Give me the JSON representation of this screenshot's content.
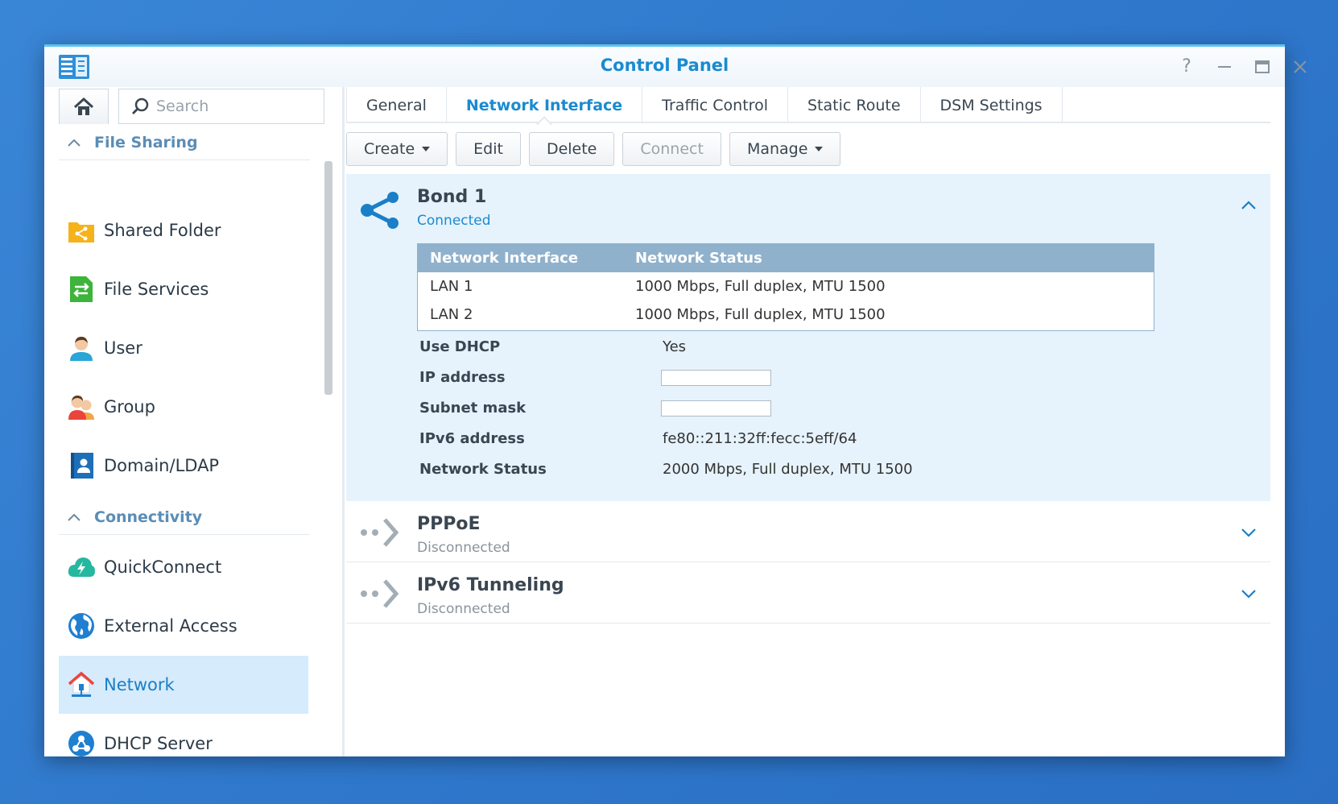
{
  "window": {
    "title": "Control Panel"
  },
  "sidebar": {
    "search_placeholder": "Search",
    "sections": [
      {
        "label": "File Sharing"
      },
      {
        "label": "Connectivity"
      }
    ],
    "items": [
      {
        "label": "Shared Folder",
        "icon": "shared-folder-icon"
      },
      {
        "label": "File Services",
        "icon": "file-services-icon"
      },
      {
        "label": "User",
        "icon": "user-icon"
      },
      {
        "label": "Group",
        "icon": "group-icon"
      },
      {
        "label": "Domain/LDAP",
        "icon": "domain-ldap-icon"
      },
      {
        "label": "QuickConnect",
        "icon": "quickconnect-icon"
      },
      {
        "label": "External Access",
        "icon": "external-access-icon"
      },
      {
        "label": "Network",
        "icon": "network-icon",
        "active": true
      },
      {
        "label": "DHCP Server",
        "icon": "dhcp-server-icon"
      }
    ]
  },
  "tabs": [
    {
      "label": "General"
    },
    {
      "label": "Network Interface",
      "active": true
    },
    {
      "label": "Traffic Control"
    },
    {
      "label": "Static Route"
    },
    {
      "label": "DSM Settings"
    }
  ],
  "toolbar": {
    "create": "Create",
    "edit": "Edit",
    "delete": "Delete",
    "connect": "Connect",
    "manage": "Manage"
  },
  "interfaces": [
    {
      "name": "Bond 1",
      "status": "Connected",
      "expanded": true,
      "table": {
        "headers": [
          "Network Interface",
          "Network Status"
        ],
        "rows": [
          [
            "LAN 1",
            "1000 Mbps, Full duplex, MTU 1500"
          ],
          [
            "LAN 2",
            "1000 Mbps, Full duplex, MTU 1500"
          ]
        ]
      },
      "properties": {
        "use_dhcp": {
          "label": "Use DHCP",
          "value": "Yes"
        },
        "ip_address": {
          "label": "IP address",
          "value": ""
        },
        "subnet_mask": {
          "label": "Subnet mask",
          "value": ""
        },
        "ipv6_address": {
          "label": "IPv6 address",
          "value": "fe80::211:32ff:fecc:5eff/64"
        },
        "network_status": {
          "label": "Network Status",
          "value": "2000 Mbps, Full duplex, MTU 1500"
        }
      }
    },
    {
      "name": "PPPoE",
      "status": "Disconnected",
      "expanded": false
    },
    {
      "name": "IPv6 Tunneling",
      "status": "Disconnected",
      "expanded": false
    }
  ],
  "colors": {
    "accent": "#1a8ad0",
    "connected": "#1a8ad0",
    "disconnected": "#8a939c",
    "expanded_bg": "#e6f3fc"
  }
}
